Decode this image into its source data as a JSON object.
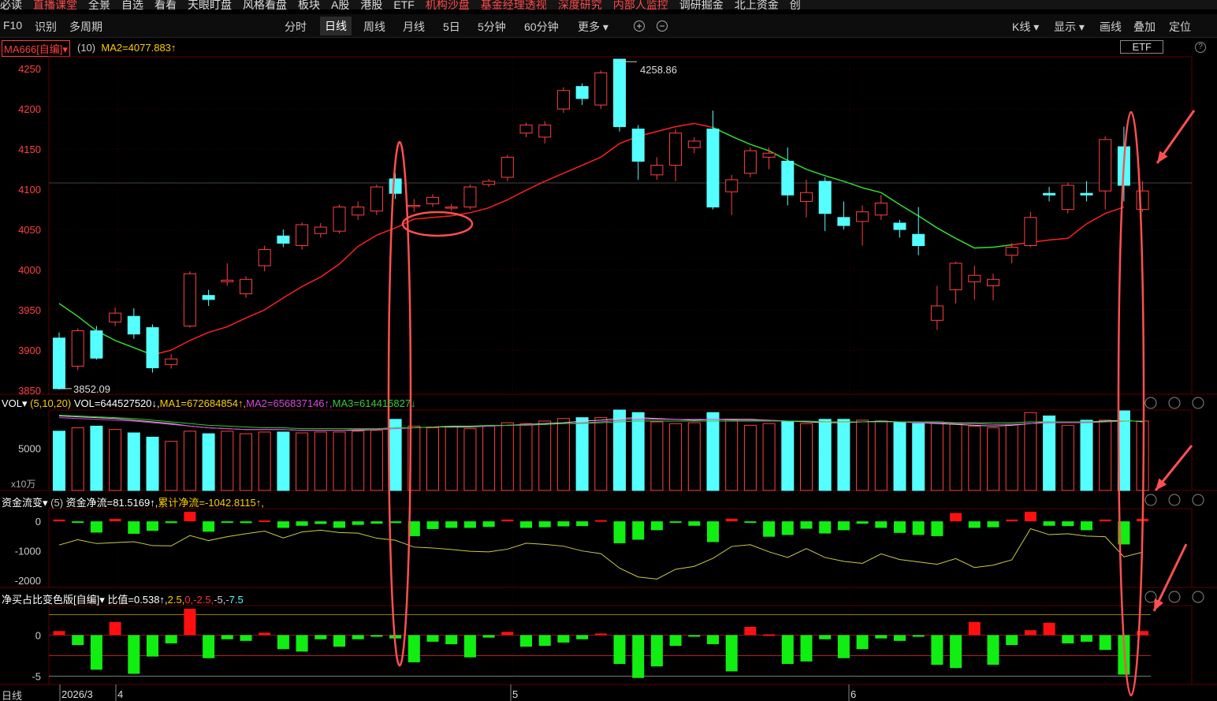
{
  "topbar": {
    "items": [
      "必读",
      "直播课堂",
      "全景",
      "自选",
      "看看",
      "天眼盯盘",
      "风格看盘",
      "板块",
      "A股",
      "港股",
      "ETF",
      "机构沙盘",
      "基金经理透视",
      "深度研究",
      "内部人监控",
      "调研掘金",
      "北上资金",
      "创"
    ],
    "red_items": [
      1,
      11,
      12,
      13,
      14
    ]
  },
  "navbar": {
    "left": [
      "F10",
      "识别",
      "多周期"
    ],
    "center": [
      "分时",
      "日线",
      "周线",
      "月线",
      "5日",
      "5分钟",
      "60分钟",
      "更多"
    ],
    "active": "日线",
    "more_arrow": "▾",
    "zoom_in": "+",
    "zoom_out": "−",
    "right": [
      "K线",
      "显示",
      "画线",
      "叠加",
      "定位"
    ]
  },
  "info": {
    "indicator": "MA666[自编]",
    "indicator_arrow": "▾",
    "period": "(10)",
    "ma_text": "MA2=4077.883↑",
    "etf_button": "ETF",
    "help": "?"
  },
  "colors": {
    "up": "#ff4040",
    "down": "#55ffff",
    "ma_red": "#ff2020",
    "ma_green": "#33dd33",
    "vol_ma1": "#cccccc",
    "vol_ma2": "#dd44dd",
    "vol_ma3": "#33cc33",
    "flow_up": "#ff1010",
    "flow_down": "#11ee11",
    "flow_line": "#cccc44",
    "grid": "#3a0000",
    "axis_text": "#ff4040",
    "highlight": "#ff5050"
  },
  "vol_panel": {
    "name": "VOL",
    "params": "(5,10,20)",
    "vol": "VOL=644527520↓,",
    "ma1": "MA1=672684854↑,",
    "ma2": "MA2=656837146↑,",
    "ma3": "MA3=614415827↓",
    "unit": "x10万"
  },
  "flow_panel": {
    "name": "资金流变",
    "params": "(5)",
    "net": "资金净流=81.5169↑,",
    "cum": "累计净流=-1042.8115↑,"
  },
  "ratio_panel": {
    "name": "净买占比变色版[自编]",
    "value": "比值=0.538↑,",
    "levels": [
      {
        "t": "2.5,",
        "c": "#ffcc00"
      },
      {
        "t": "0,",
        "c": "#ff3030"
      },
      {
        "t": "-2.5,",
        "c": "#ff3030"
      },
      {
        "t": "-5,",
        "c": "#cccccc"
      },
      {
        "t": "-7.5",
        "c": "#55ffff"
      }
    ]
  },
  "date_axis": {
    "label": "日线",
    "labels": [
      "2026/3",
      "4",
      "5",
      "6"
    ]
  },
  "chart_data": {
    "type": "candlestick",
    "price_axis": {
      "ticks": [
        4250,
        4200,
        4150,
        4100,
        4050,
        4000,
        3950,
        3900,
        3850
      ],
      "range": [
        3848,
        4262
      ]
    },
    "annotations": {
      "high": "4258.86",
      "low": "3852.09"
    },
    "candles": [
      [
        3915,
        3852,
        3922,
        3851
      ],
      [
        3880,
        3924,
        3927,
        3875
      ],
      [
        3924,
        3890,
        3930,
        3888
      ],
      [
        3935,
        3946,
        3953,
        3930
      ],
      [
        3942,
        3920,
        3952,
        3914
      ],
      [
        3928,
        3878,
        3932,
        3872
      ],
      [
        3882,
        3889,
        3895,
        3877
      ],
      [
        3930,
        3995,
        3998,
        3928
      ],
      [
        3968,
        3963,
        3975,
        3955
      ],
      [
        3985,
        3987,
        4008,
        3980
      ],
      [
        3970,
        3988,
        3992,
        3965
      ],
      [
        4005,
        4025,
        4030,
        3998
      ],
      [
        4042,
        4033,
        4050,
        4028
      ],
      [
        4030,
        4056,
        4059,
        4025
      ],
      [
        4045,
        4053,
        4058,
        4040
      ],
      [
        4048,
        4078,
        4081,
        4045
      ],
      [
        4068,
        4078,
        4085,
        4062
      ],
      [
        4073,
        4103,
        4106,
        4068
      ],
      [
        4113,
        4095,
        4120,
        4088
      ],
      [
        4080,
        4080,
        4088,
        4072
      ],
      [
        4082,
        4090,
        4094,
        4078
      ],
      [
        4077,
        4078,
        4082,
        4073
      ],
      [
        4078,
        4103,
        4106,
        4075
      ],
      [
        4106,
        4110,
        4113,
        4103
      ],
      [
        4115,
        4140,
        4143,
        4110
      ],
      [
        4170,
        4180,
        4183,
        4165
      ],
      [
        4165,
        4180,
        4185,
        4157
      ],
      [
        4200,
        4223,
        4227,
        4195
      ],
      [
        4228,
        4213,
        4232,
        4205
      ],
      [
        4205,
        4245,
        4248,
        4200
      ],
      [
        4262,
        4178,
        4262,
        4172
      ],
      [
        4175,
        4135,
        4180,
        4112
      ],
      [
        4118,
        4130,
        4140,
        4112
      ],
      [
        4130,
        4170,
        4175,
        4110
      ],
      [
        4152,
        4160,
        4165,
        4145
      ],
      [
        4175,
        4078,
        4198,
        4075
      ],
      [
        4097,
        4112,
        4118,
        4068
      ],
      [
        4120,
        4148,
        4152,
        4115
      ],
      [
        4140,
        4145,
        4152,
        4125
      ],
      [
        4135,
        4093,
        4152,
        4080
      ],
      [
        4085,
        4096,
        4112,
        4065
      ],
      [
        4110,
        4070,
        4115,
        4048
      ],
      [
        4065,
        4055,
        4085,
        4050
      ],
      [
        4060,
        4072,
        4080,
        4030
      ],
      [
        4068,
        4083,
        4093,
        4062
      ],
      [
        4058,
        4050,
        4062,
        4040
      ],
      [
        4044,
        4030,
        4078,
        4018
      ],
      [
        3937,
        3955,
        3980,
        3925
      ],
      [
        3975,
        4008,
        4010,
        3958
      ],
      [
        3985,
        3993,
        4005,
        3963
      ],
      [
        3980,
        3988,
        3995,
        3962
      ],
      [
        4018,
        4028,
        4033,
        4008
      ],
      [
        4030,
        4065,
        4072,
        4028
      ],
      [
        4095,
        4093,
        4103,
        4085
      ],
      [
        4075,
        4105,
        4108,
        4070
      ],
      [
        4095,
        4093,
        4110,
        4085
      ],
      [
        4098,
        4162,
        4166,
        4075
      ],
      [
        4153,
        4105,
        4178,
        4085
      ],
      [
        4075,
        4098,
        4110,
        4072
      ]
    ],
    "ma2": [
      3958,
      3942,
      3924,
      3912,
      3903,
      3894,
      3900,
      3912,
      3922,
      3929,
      3940,
      3950,
      3965,
      3979,
      3991,
      4007,
      4029,
      4043,
      4052,
      4063,
      4065,
      4067,
      4071,
      4077,
      4087,
      4099,
      4110,
      4120,
      4130,
      4140,
      4157,
      4166,
      4172,
      4178,
      4182,
      4177,
      4166,
      4156,
      4148,
      4136,
      4125,
      4117,
      4110,
      4102,
      4096,
      4081,
      4067,
      4052,
      4039,
      4027,
      4028,
      4031,
      4034,
      4037,
      4039,
      4057,
      4070,
      4078
    ],
    "ma2_green_segments": [
      [
        0,
        5
      ],
      [
        35,
        51
      ]
    ],
    "volume": {
      "axis_ticks": [
        5000
      ],
      "max": 9500,
      "bars": [
        7000,
        7400,
        7600,
        7200,
        6800,
        6300,
        5800,
        7000,
        6700,
        7000,
        6700,
        6900,
        6900,
        6800,
        6900,
        6900,
        7000,
        7100,
        8400,
        7600,
        7400,
        7500,
        7300,
        7600,
        8000,
        7900,
        8200,
        8500,
        8600,
        8600,
        9500,
        9200,
        8100,
        7900,
        8000,
        9200,
        8400,
        7700,
        7900,
        8200,
        7900,
        8400,
        8400,
        8300,
        8200,
        8100,
        7900,
        8100,
        7900,
        7600,
        7400,
        7800,
        9200,
        8800,
        7700,
        8300,
        8300,
        9400,
        8200
      ],
      "ma1": [
        8800,
        8700,
        8600,
        8500,
        8300,
        8100,
        7900,
        7600,
        7400,
        7300,
        7200,
        7200,
        7200,
        7100,
        7100,
        7100,
        7100,
        7200,
        7300,
        7400,
        7500,
        7500,
        7500,
        7600,
        7700,
        7800,
        7900,
        8000,
        8200,
        8300,
        8500,
        8600,
        8500,
        8400,
        8300,
        8400,
        8400,
        8400,
        8300,
        8200,
        8100,
        8000,
        8000,
        8100,
        8200,
        8100,
        8000,
        7900,
        7800,
        7700,
        7600,
        7700,
        7900,
        8100,
        8100,
        8100,
        8200,
        8300,
        8100
      ],
      "ma2": [
        8600,
        8500,
        8400,
        8300,
        8200,
        8000,
        7800,
        7600,
        7400,
        7300,
        7200,
        7200,
        7200,
        7100,
        7100,
        7100,
        7200,
        7200,
        7300,
        7400,
        7500,
        7600,
        7600,
        7600,
        7700,
        7700,
        7800,
        7900,
        8000,
        8100,
        8300,
        8400,
        8400,
        8400,
        8400,
        8400,
        8300,
        8300,
        8300,
        8200,
        8200,
        8100,
        8100,
        8100,
        8100,
        8100,
        8000,
        8000,
        7900,
        7900,
        7800,
        7800,
        7900,
        8000,
        8000,
        8000,
        8100,
        8200,
        8200
      ],
      "ma3": [
        8900,
        8800,
        8700,
        8600,
        8500,
        8300,
        8100,
        7900,
        7700,
        7600,
        7500,
        7400,
        7400,
        7300,
        7300,
        7300,
        7300,
        7300,
        7400,
        7400,
        7500,
        7600,
        7600,
        7700,
        7700,
        7800,
        7800,
        7900,
        7900,
        8000,
        8100,
        8200,
        8200,
        8200,
        8200,
        8200,
        8200,
        8200,
        8200,
        8200,
        8200,
        8100,
        8100,
        8100,
        8100,
        8100,
        8100,
        8100,
        8000,
        8000,
        8000,
        8000,
        8100,
        8100,
        8100,
        8100,
        8100,
        8200,
        8200
      ]
    },
    "fund_flow": {
      "axis_ticks": [
        0,
        -1000,
        -2000
      ],
      "range": [
        -2100,
        350
      ],
      "bars": [
        60,
        -20,
        -380,
        80,
        -420,
        -320,
        -60,
        320,
        -350,
        -50,
        -60,
        30,
        -220,
        -150,
        -90,
        -220,
        -120,
        -80,
        -60,
        -500,
        -260,
        -220,
        -220,
        -190,
        60,
        -220,
        -200,
        -170,
        -160,
        40,
        -740,
        -620,
        -300,
        -40,
        -150,
        -700,
        90,
        -20,
        -520,
        -460,
        -250,
        -410,
        -300,
        -80,
        -220,
        -390,
        -460,
        -500,
        280,
        -220,
        -200,
        60,
        320,
        -150,
        -160,
        -300,
        60,
        -780,
        82
      ],
      "line": [
        -800,
        -620,
        -750,
        -720,
        -690,
        -820,
        -830,
        -480,
        -650,
        -520,
        -420,
        -330,
        -560,
        -360,
        -300,
        -380,
        -400,
        -570,
        -640,
        -870,
        -900,
        -950,
        -1010,
        -1030,
        -940,
        -740,
        -780,
        -840,
        -1000,
        -1090,
        -1580,
        -1880,
        -1950,
        -1620,
        -1520,
        -1250,
        -850,
        -790,
        -1030,
        -1220,
        -920,
        -1220,
        -1350,
        -1420,
        -1100,
        -1290,
        -1370,
        -1450,
        -1260,
        -1560,
        -1480,
        -1300,
        -250,
        -450,
        -420,
        -500,
        -520,
        -1200,
        -1042
      ]
    },
    "net_ratio": {
      "axis_ticks": [
        0,
        -5
      ],
      "range": [
        -5.8,
        3.4
      ],
      "levels": [
        2.5,
        0,
        -2.5,
        -5,
        -7.5
      ],
      "bars": [
        0.5,
        -1.2,
        -4.2,
        1.6,
        -4.7,
        -2.6,
        -1.0,
        3.2,
        -2.8,
        -0.5,
        -0.7,
        0.3,
        -1.7,
        -2.0,
        -0.5,
        -1.4,
        -0.5,
        -0.2,
        -0.4,
        -3.3,
        -0.8,
        -1.1,
        -2.7,
        -0.3,
        0.4,
        -1.4,
        -1.3,
        -0.9,
        -0.5,
        0.2,
        -3.5,
        -5.2,
        -3.8,
        -1.3,
        -0.1,
        -1.1,
        -4.4,
        1.0,
        0.1,
        -3.5,
        -3.2,
        -0.5,
        -2.8,
        -1.7,
        -0.4,
        -0.7,
        -0.2,
        -3.6,
        -4.0,
        1.6,
        -3.6,
        -1.2,
        0.6,
        1.5,
        -1.0,
        -0.8,
        -1.8,
        -4.8,
        0.5
      ]
    }
  }
}
